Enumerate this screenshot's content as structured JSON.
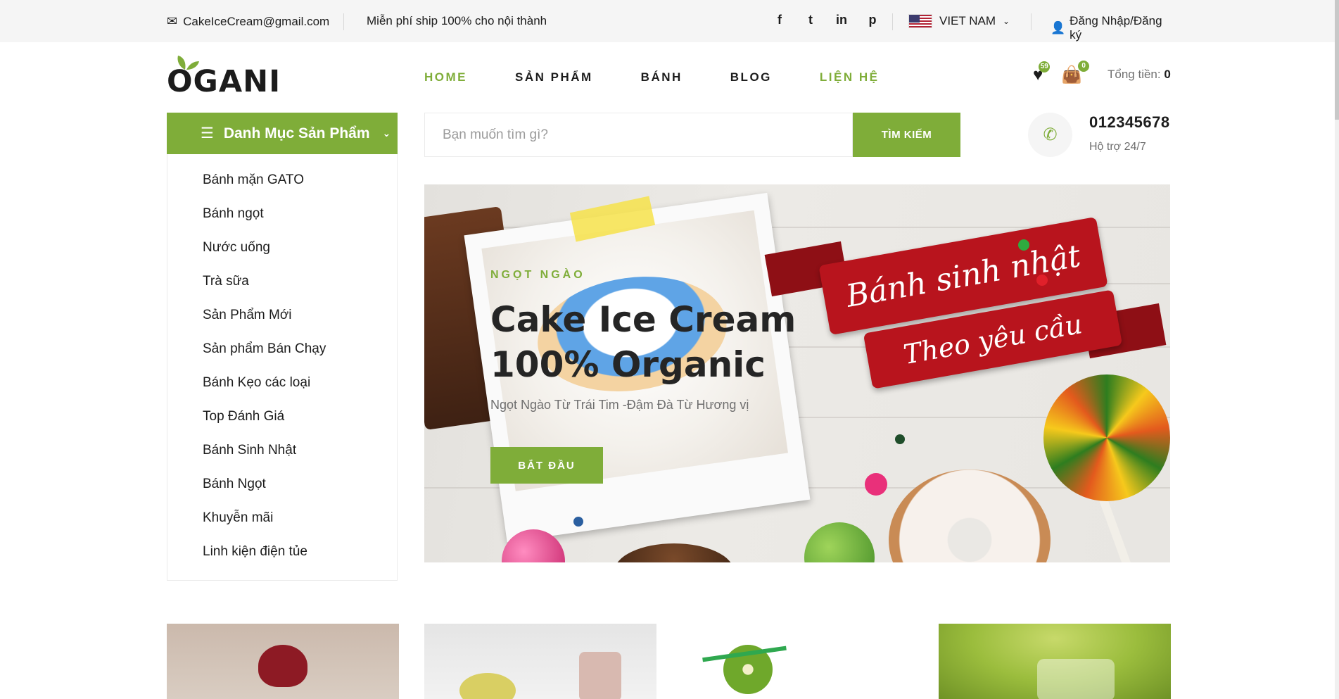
{
  "topbar": {
    "email": "CakeIceCream@gmail.com",
    "shipping": "Miễn phí ship 100% cho nội thành",
    "social": [
      {
        "icon": "facebook-icon",
        "glyph": "f"
      },
      {
        "icon": "twitter-icon",
        "glyph": "t"
      },
      {
        "icon": "linkedin-icon",
        "glyph": "in"
      },
      {
        "icon": "pinterest-icon",
        "glyph": "p"
      }
    ],
    "language": "VIET NAM",
    "login": "Đăng Nhập/Đăng ký"
  },
  "header": {
    "logo": "OGANI",
    "nav": [
      {
        "label": "HOME",
        "active": true
      },
      {
        "label": "SẢN PHẨM",
        "active": false
      },
      {
        "label": "BÁNH",
        "active": false
      },
      {
        "label": "BLOG",
        "active": false
      },
      {
        "label": "LIỆN HỆ",
        "active": true
      }
    ],
    "wishlist_count": "59",
    "cart_count": "0",
    "total_label": "Tổng tiền:",
    "total_value": "0"
  },
  "categories": {
    "title": "Danh Mục Sản Phẩm",
    "items": [
      "Bánh mặn GATO",
      "Bánh ngọt",
      "Nước uống",
      "Trà sữa",
      "Sản Phẩm Mới",
      "Sản phẩm Bán Chạy",
      "Bánh Kẹo các loại",
      "Top Đánh Giá",
      "Bánh Sinh Nhật",
      "Bánh Ngọt",
      "Khuyễn mãi",
      "Linh kiện điện tủe"
    ]
  },
  "search": {
    "placeholder": "Bạn muốn tìm gì?",
    "button": "TÌM KIẾM"
  },
  "support": {
    "phone": "012345678",
    "note": "Hộ trợ 24/7"
  },
  "hero": {
    "tag": "NGỌT NGÀO",
    "title_line1": "Cake Ice Cream",
    "title_line2": "100% Organic",
    "description": "Ngọt Ngào Từ Trái Tim -Đậm Đà Từ Hương vị",
    "button": "BẮT ĐẦU",
    "banner_line1": "Bánh sinh nhật",
    "banner_line2": "Theo yêu cầu"
  },
  "colors": {
    "accent": "#7fad39",
    "topbar_bg": "#f5f5f5",
    "banner_red": "#b8141d",
    "text": "#1c1c1c"
  }
}
